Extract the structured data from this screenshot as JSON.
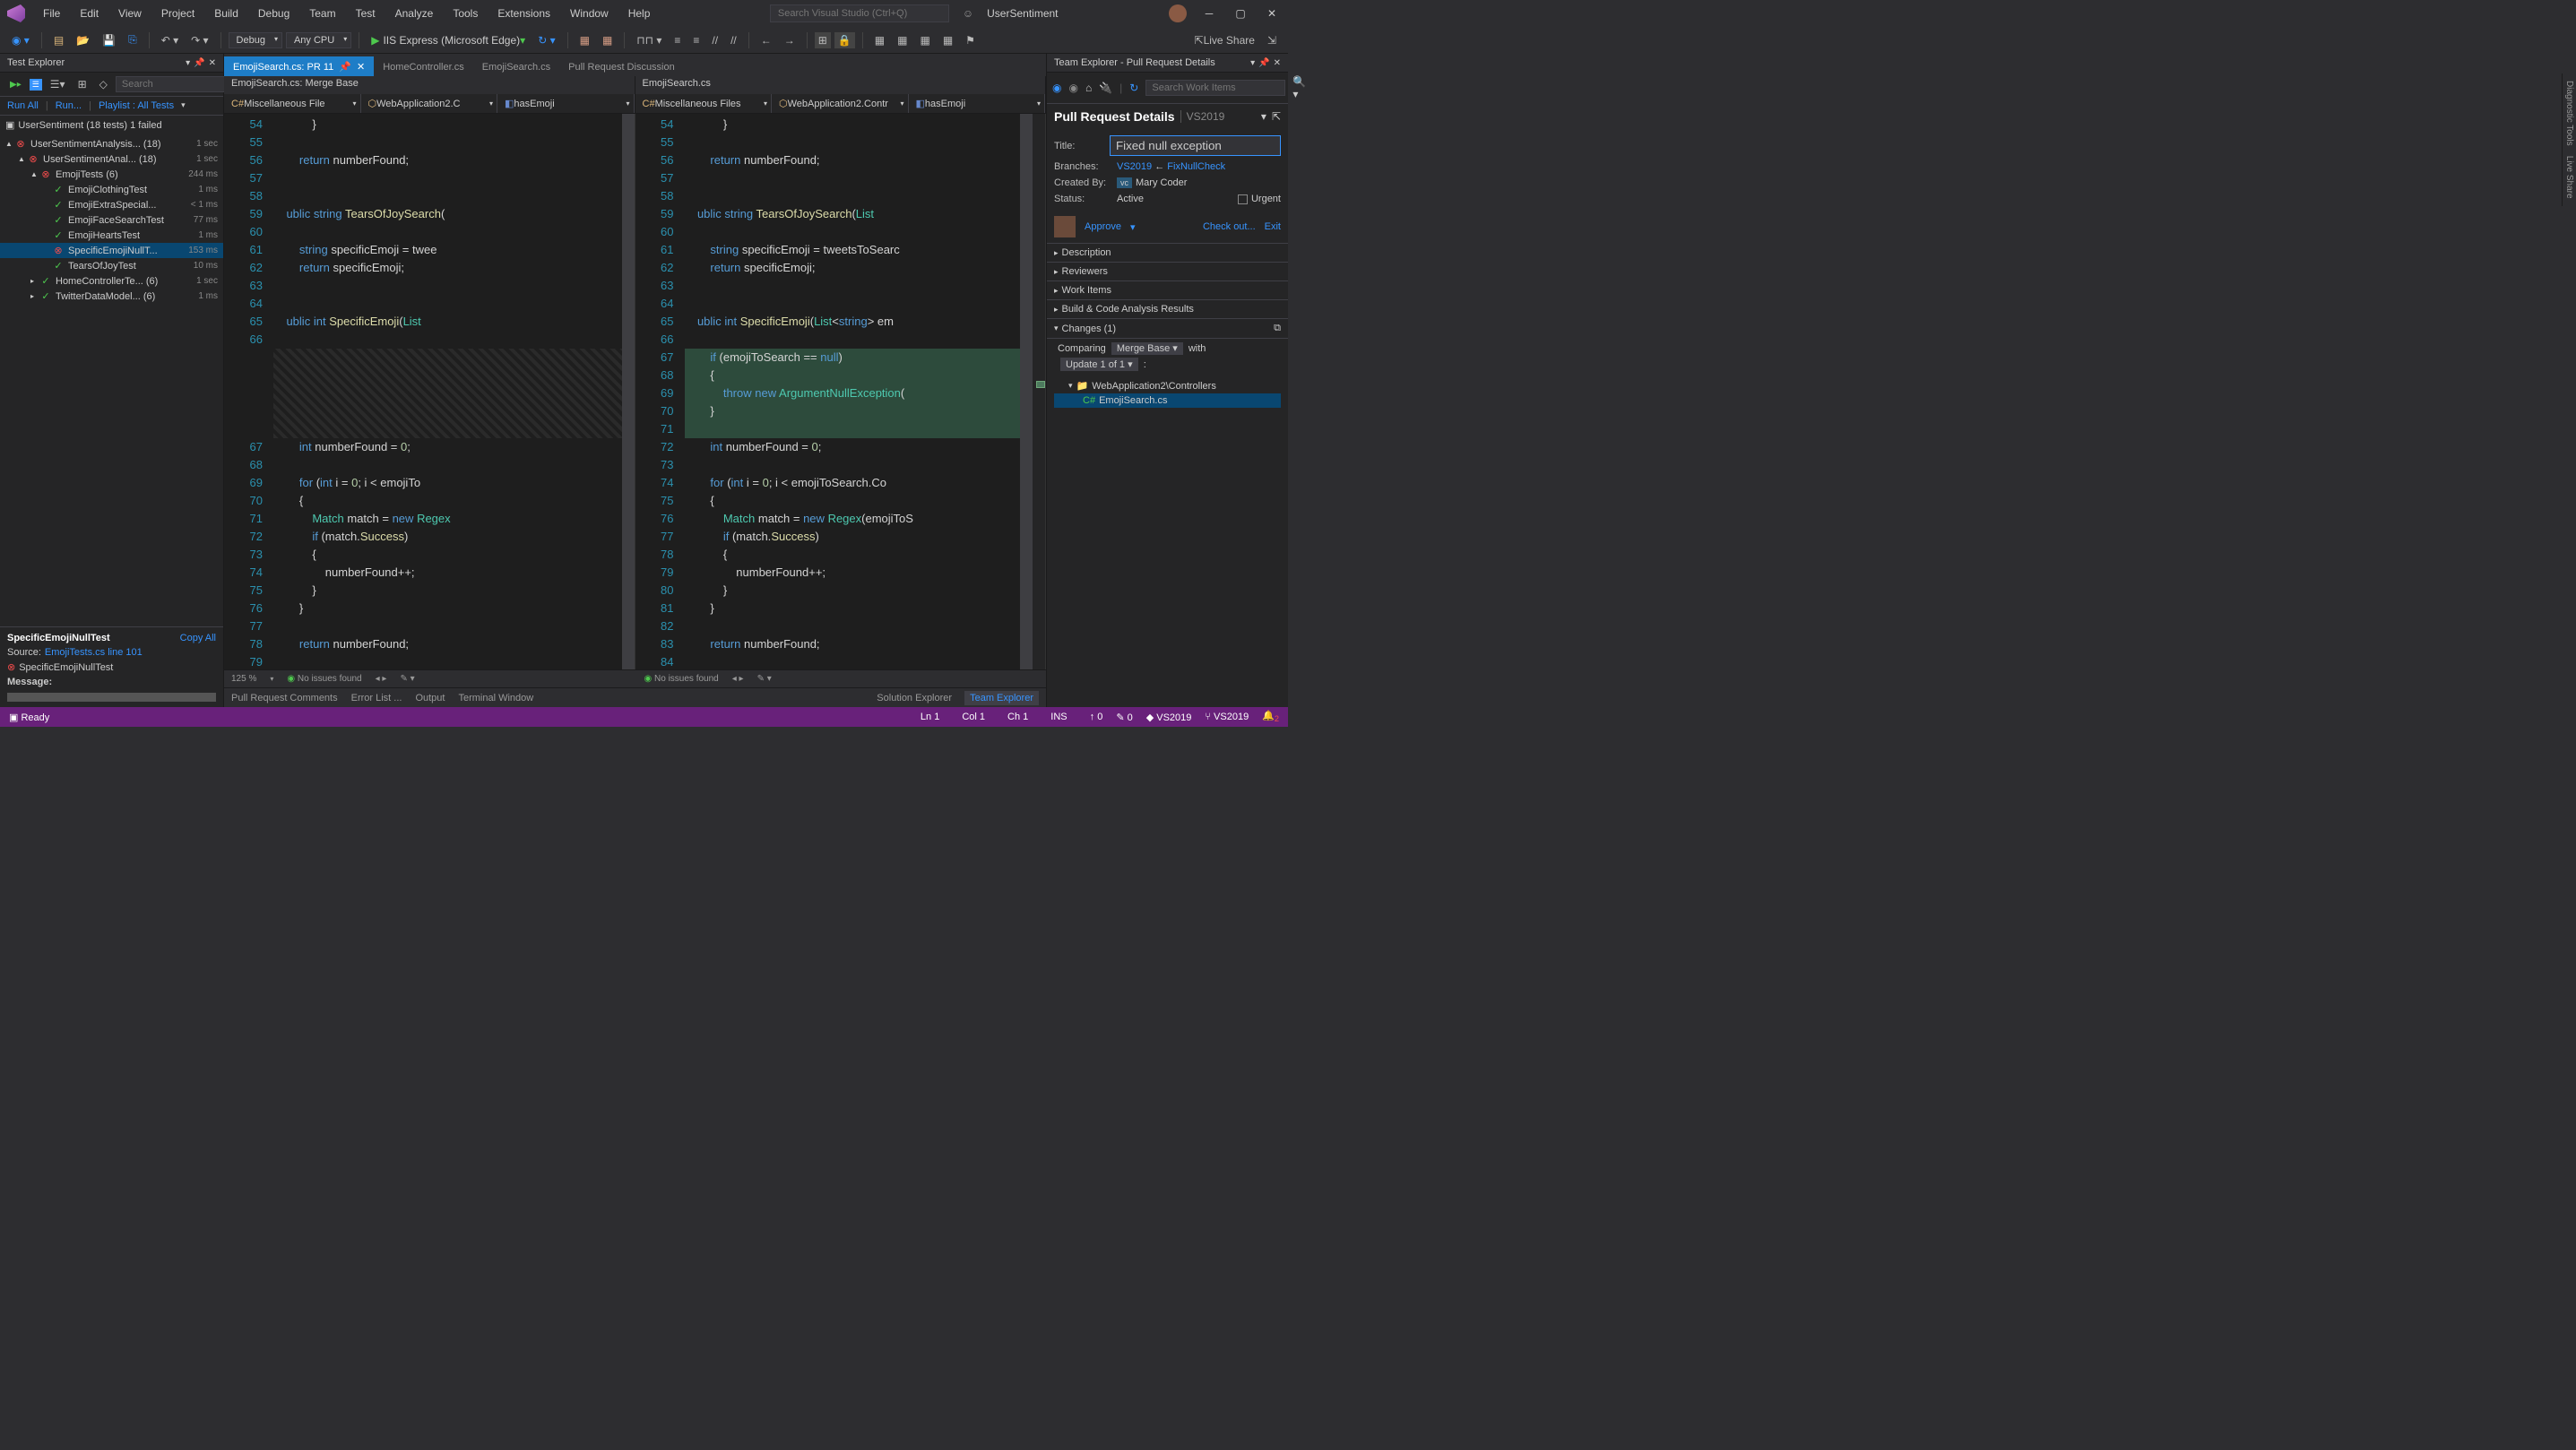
{
  "menu": [
    "File",
    "Edit",
    "View",
    "Project",
    "Build",
    "Debug",
    "Team",
    "Test",
    "Analyze",
    "Tools",
    "Extensions",
    "Window",
    "Help"
  ],
  "titlebar": {
    "search_placeholder": "Search Visual Studio (Ctrl+Q)",
    "solution": "UserSentiment"
  },
  "toolbar": {
    "config": "Debug",
    "platform": "Any CPU",
    "run": "IIS Express (Microsoft Edge)",
    "live_share": "Live Share"
  },
  "test_explorer": {
    "title": "Test Explorer",
    "search_placeholder": "Search",
    "links": {
      "run_all": "Run All",
      "run": "Run...",
      "playlist": "Playlist : All Tests"
    },
    "summary": "UserSentiment (18 tests) 1 failed",
    "tree": [
      {
        "indent": 0,
        "status": "fail",
        "label": "UserSentimentAnalysis... (18)",
        "time": "1 sec",
        "expand": "▲"
      },
      {
        "indent": 1,
        "status": "fail",
        "label": "UserSentimentAnal... (18)",
        "time": "1 sec",
        "expand": "▲"
      },
      {
        "indent": 2,
        "status": "fail",
        "label": "EmojiTests (6)",
        "time": "244 ms",
        "expand": "▲"
      },
      {
        "indent": 3,
        "status": "pass",
        "label": "EmojiClothingTest",
        "time": "1 ms"
      },
      {
        "indent": 3,
        "status": "pass",
        "label": "EmojiExtraSpecial...",
        "time": "< 1 ms"
      },
      {
        "indent": 3,
        "status": "pass",
        "label": "EmojiFaceSearchTest",
        "time": "77 ms"
      },
      {
        "indent": 3,
        "status": "pass",
        "label": "EmojiHeartsTest",
        "time": "1 ms"
      },
      {
        "indent": 3,
        "status": "fail",
        "label": "SpecificEmojiNullT...",
        "time": "153 ms",
        "selected": true
      },
      {
        "indent": 3,
        "status": "pass",
        "label": "TearsOfJoyTest",
        "time": "10 ms"
      },
      {
        "indent": 2,
        "status": "pass",
        "label": "HomeControllerTe... (6)",
        "time": "1 sec",
        "expand": "▸"
      },
      {
        "indent": 2,
        "status": "pass",
        "label": "TwitterDataModel... (6)",
        "time": "1 ms",
        "expand": "▸"
      }
    ],
    "detail": {
      "title": "SpecificEmojiNullTest",
      "copy": "Copy All",
      "source_label": "Source:",
      "source_link": "EmojiTests.cs line 101",
      "fail_name": "SpecificEmojiNullTest",
      "message_label": "Message:"
    }
  },
  "tabs": [
    {
      "label": "EmojiSearch.cs: PR 11",
      "active": true,
      "pinned": true,
      "close": true
    },
    {
      "label": "HomeController.cs"
    },
    {
      "label": "EmojiSearch.cs"
    },
    {
      "label": "Pull Request Discussion"
    }
  ],
  "subtabs": {
    "left": "EmojiSearch.cs: Merge Base",
    "right": "EmojiSearch.cs"
  },
  "nav": {
    "left": [
      "Miscellaneous File",
      "WebApplication2.C",
      "hasEmoji"
    ],
    "right": [
      "Miscellaneous Files",
      "WebApplication2.Contr",
      "hasEmoji"
    ]
  },
  "code_left": {
    "start": 54,
    "lines": [
      "            }",
      "",
      "        return numberFound;",
      "",
      "",
      "    ublic string TearsOfJoySearch(",
      "",
      "        string specificEmoji = twee",
      "        return specificEmoji;",
      "",
      "",
      "    ublic int SpecificEmoji(List<s",
      "",
      "HATCH",
      "        int numberFound = 0;",
      "",
      "        for (int i = 0; i < emojiTo",
      "        {",
      "            Match match = new Regex",
      "            if (match.Success)",
      "            {",
      "                numberFound++;",
      "            }",
      "        }",
      "",
      "        return numberFound;",
      ""
    ]
  },
  "code_right": {
    "start": 54,
    "lines": [
      "            }",
      "",
      "        return numberFound;",
      "",
      "",
      "    ublic string TearsOfJoySearch(List<stri",
      "",
      "        string specificEmoji = tweetsToSearc",
      "        return specificEmoji;",
      "",
      "",
      "    ublic int SpecificEmoji(List<string> em",
      "",
      "ADD:        if (emojiToSearch == null)",
      "ADD:        {",
      "ADD:            throw new ArgumentNullException(",
      "ADD:        }",
      "ADD:",
      "        int numberFound = 0;",
      "",
      "        for (int i = 0; i < emojiToSearch.Co",
      "        {",
      "            Match match = new Regex(emojiToS",
      "            if (match.Success)",
      "            {",
      "                numberFound++;",
      "            }",
      "        }",
      "",
      "        return numberFound;",
      ""
    ]
  },
  "editor_status": {
    "zoom": "125 %",
    "issues": "No issues found"
  },
  "team_explorer": {
    "title": "Team Explorer - Pull Request Details",
    "search_placeholder": "Search Work Items",
    "header": "Pull Request Details",
    "header_sub": "VS2019",
    "title_label": "Title:",
    "title_value": "Fixed null exception",
    "branches_label": "Branches:",
    "branch_target": "VS2019",
    "branch_source": "FixNullCheck",
    "created_label": "Created By:",
    "created_badge": "vc",
    "created_name": "Mary Coder",
    "status_label": "Status:",
    "status_value": "Active",
    "urgent": "Urgent",
    "approve": "Approve",
    "checkout": "Check out...",
    "exit": "Exit",
    "sections": [
      "Description",
      "Reviewers",
      "Work Items",
      "Build & Code Analysis Results"
    ],
    "changes": "Changes (1)",
    "comparing": "Comparing",
    "compare_base": "Merge Base",
    "with": "with",
    "update": "Update 1 of 1",
    "folder": "WebApplication2\\Controllers",
    "file": "EmojiSearch.cs"
  },
  "bottom_tabs": [
    "Pull Request Comments",
    "Error List ...",
    "Output",
    "Terminal Window"
  ],
  "right_bottom_tabs": {
    "solution": "Solution Explorer",
    "team": "Team Explorer"
  },
  "statusbar": {
    "ready": "Ready",
    "ln": "Ln 1",
    "col": "Col 1",
    "ch": "Ch 1",
    "ins": "INS",
    "up": "0",
    "pen": "0",
    "repo": "VS2019",
    "branch": "VS2019",
    "notif": "2"
  },
  "vert_tabs": [
    "Diagnostic Tools",
    "Live Share"
  ]
}
